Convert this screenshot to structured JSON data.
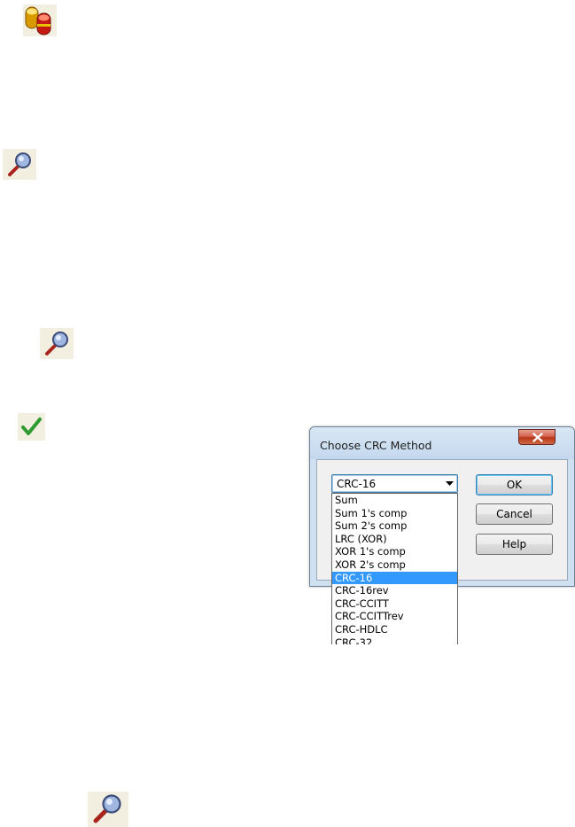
{
  "icons": [
    {
      "name": "database-icon"
    },
    {
      "name": "magnifier-icon"
    },
    {
      "name": "magnifier-icon"
    },
    {
      "name": "checkmark-icon"
    },
    {
      "name": "magnifier-icon"
    }
  ],
  "dialog": {
    "title": "Choose CRC Method",
    "close_glyph": "x",
    "combo": {
      "value": "CRC-16"
    },
    "list": {
      "items": [
        "Sum",
        "Sum 1's comp",
        "Sum 2's comp",
        "LRC (XOR)",
        "XOR 1's comp",
        "XOR 2's comp",
        "CRC-16",
        "CRC-16rev",
        "CRC-CCITT",
        "CRC-CCITTrev",
        "CRC-HDLC",
        "CRC-32"
      ],
      "selected": "CRC-16"
    },
    "buttons": {
      "ok": "OK",
      "cancel": "Cancel",
      "help": "Help"
    }
  },
  "colors": {
    "selection": "#3399ff",
    "title_bar": "#cfe0f1",
    "close_button": "#c8442a"
  }
}
